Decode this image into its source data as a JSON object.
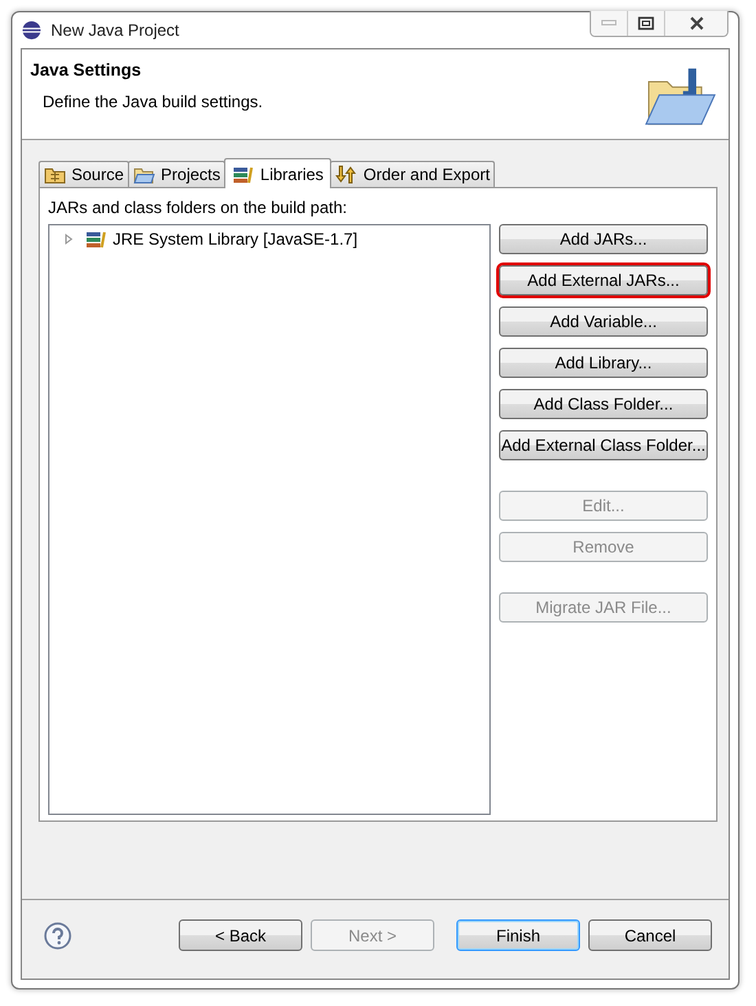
{
  "window": {
    "title": "New Java Project"
  },
  "header": {
    "title": "Java Settings",
    "description": "Define the Java build settings."
  },
  "tabs": [
    {
      "label": "Source",
      "kind": "source",
      "selected": false
    },
    {
      "label": "Projects",
      "kind": "projects",
      "selected": false
    },
    {
      "label": "Libraries",
      "kind": "libraries",
      "selected": true
    },
    {
      "label": "Order and Export",
      "kind": "order",
      "selected": false
    }
  ],
  "libraries": {
    "label": "JARs and class folders on the build path:",
    "tree": [
      {
        "label": "JRE System Library [JavaSE-1.7]",
        "expanded": false
      }
    ],
    "button_groups": [
      [
        {
          "label": "Add JARs...",
          "disabled": false,
          "highlighted": false
        },
        {
          "label": "Add External JARs...",
          "disabled": false,
          "highlighted": true
        },
        {
          "label": "Add Variable...",
          "disabled": false,
          "highlighted": false
        },
        {
          "label": "Add Library...",
          "disabled": false,
          "highlighted": false
        },
        {
          "label": "Add Class Folder...",
          "disabled": false,
          "highlighted": false
        },
        {
          "label": "Add External Class Folder...",
          "disabled": false,
          "highlighted": false
        }
      ],
      [
        {
          "label": "Edit...",
          "disabled": true,
          "highlighted": false
        },
        {
          "label": "Remove",
          "disabled": true,
          "highlighted": false
        }
      ],
      [
        {
          "label": "Migrate JAR File...",
          "disabled": true,
          "highlighted": false
        }
      ]
    ]
  },
  "footer": {
    "buttons": [
      {
        "label": "< Back",
        "disabled": false,
        "default": false
      },
      {
        "label": "Next >",
        "disabled": true,
        "default": false
      },
      {
        "label": "Finish",
        "disabled": false,
        "default": true
      },
      {
        "label": "Cancel",
        "disabled": false,
        "default": false
      }
    ]
  }
}
